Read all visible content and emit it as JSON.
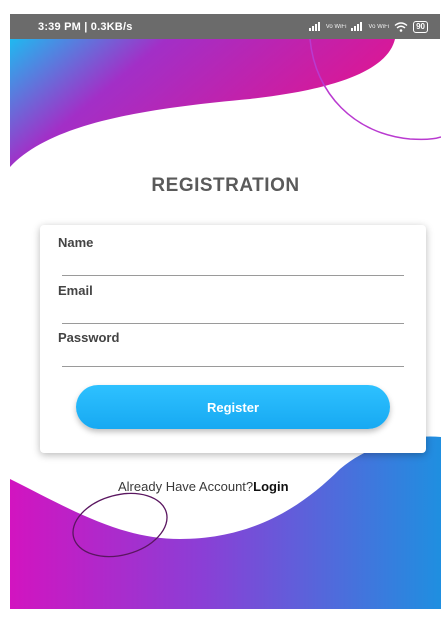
{
  "status_bar": {
    "time_speed": "3:39 PM | 0.3KB/s",
    "volte_1": "Vo WiFi",
    "volte_2": "Vo WiFi",
    "battery": "90"
  },
  "page": {
    "title": "REGISTRATION"
  },
  "form": {
    "name_label": "Name",
    "email_label": "Email",
    "password_label": "Password",
    "name_value": "",
    "email_value": "",
    "password_value": "",
    "register_label": "Register"
  },
  "footer": {
    "prompt": "Already Have Account?",
    "login_label": "Login"
  },
  "colors": {
    "status_bar": "#6b6b6b",
    "wave_top_start": "#1fb9f0",
    "wave_top_mid": "#a22fc7",
    "wave_top_end": "#e2148f",
    "wave_bottom_start": "#d214c0",
    "wave_bottom_mid": "#8a3fd6",
    "wave_bottom_end": "#1f8fe0",
    "button": "#1cb3f7",
    "title_text": "#5a5a5a"
  }
}
